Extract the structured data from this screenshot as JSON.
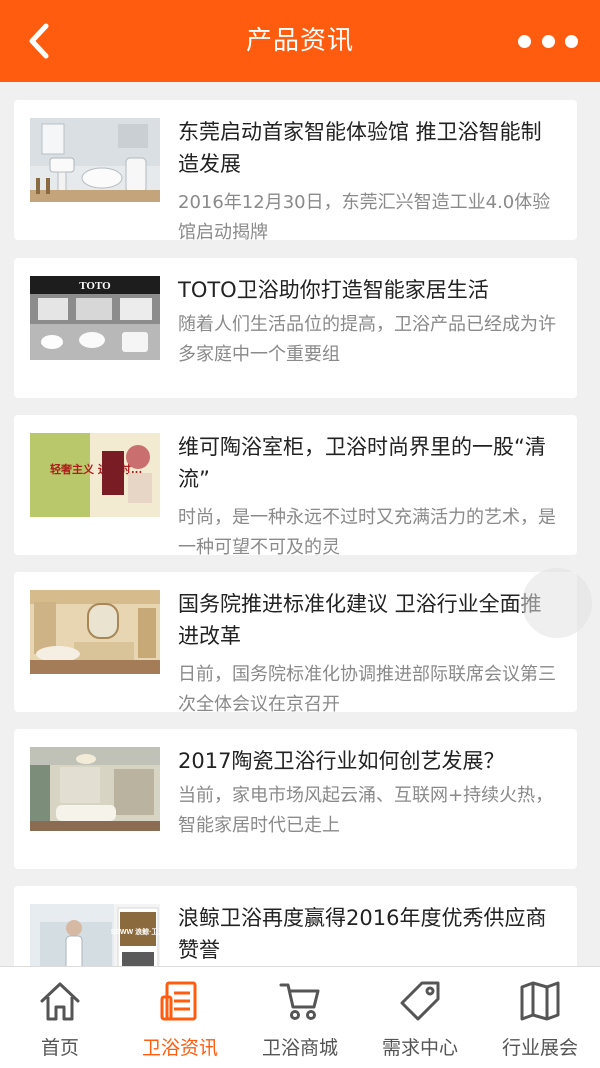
{
  "header": {
    "title": "产品资讯",
    "back_icon": "chevron-left-icon",
    "more_icon": "more-dots-icon",
    "color": "#ff5c0f"
  },
  "articles": [
    {
      "title": "东莞启动首家智能体验馆 推卫浴智能制造发展",
      "summary": "2016年12月30日，东莞汇兴智造工业4.0体验馆启动揭牌"
    },
    {
      "title": "TOTO卫浴助你打造智能家居生活",
      "summary": "随着人们生活品位的提高，卫浴产品已经成为许多家庭中一个重要组",
      "thumb_text": "TOTO"
    },
    {
      "title": "维可陶浴室柜，卫浴时尚界里的一股“清流”",
      "summary": "时尚，是一种永远不过时又充满活力的艺术，是一种可望不可及的灵",
      "thumb_text": "轻奢主义 进行时..."
    },
    {
      "title": "国务院推进标准化建议 卫浴行业全面推进改革",
      "summary": "日前，国务院标准化协调推进部际联席会议第三次全体会议在京召开"
    },
    {
      "title": "2017陶瓷卫浴行业如何创艺发展？",
      "summary": "当前，家电市场风起云涌、互联网+持续火热，智能家居时代已走上"
    },
    {
      "title": "浪鲸卫浴再度赢得2016年度优秀供应商赞誉",
      "summary": "",
      "thumb_text": "SSWW 浪鲸·卫浴"
    }
  ],
  "tabs": [
    {
      "label": "首页",
      "icon": "home-icon",
      "active": false
    },
    {
      "label": "卫浴资讯",
      "icon": "news-icon",
      "active": true
    },
    {
      "label": "卫浴商城",
      "icon": "cart-icon",
      "active": false
    },
    {
      "label": "需求中心",
      "icon": "tag-icon",
      "active": false
    },
    {
      "label": "行业展会",
      "icon": "map-icon",
      "active": false
    }
  ]
}
